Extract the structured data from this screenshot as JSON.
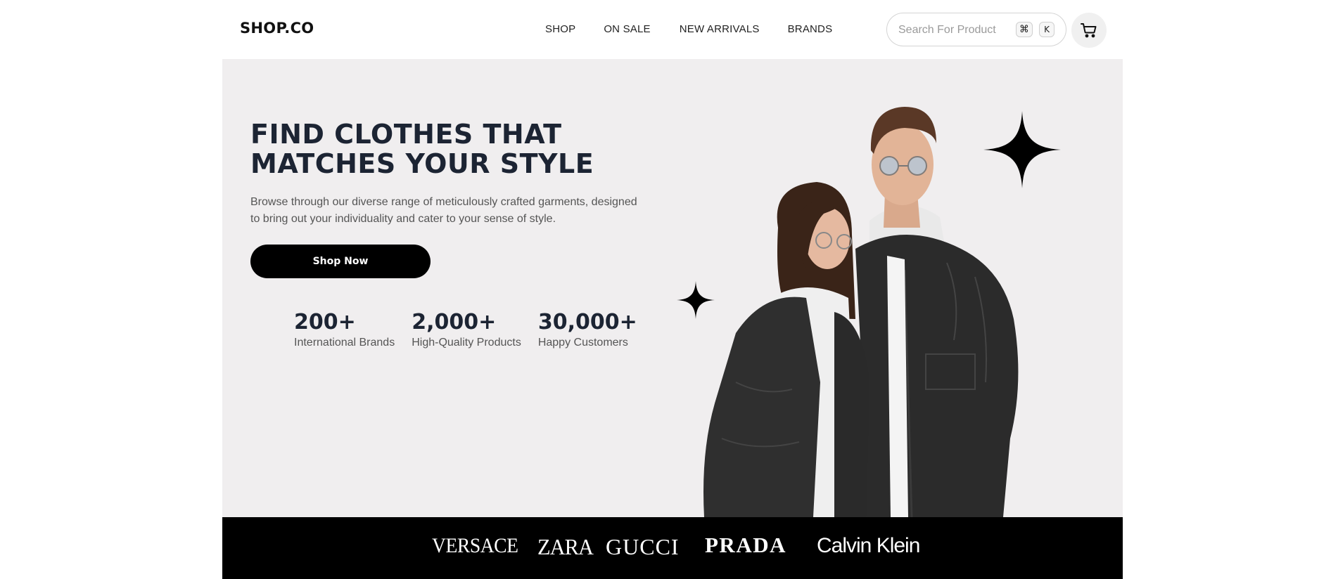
{
  "header": {
    "logo": "SHOP.CO",
    "nav": [
      {
        "label": "SHOP"
      },
      {
        "label": "ON SALE"
      },
      {
        "label": "NEW ARRIVALS"
      },
      {
        "label": "BRANDS"
      }
    ],
    "search": {
      "placeholder": "Search For Product",
      "shortcut_keys": [
        "⌘",
        "K"
      ]
    },
    "cart_icon": "cart-icon"
  },
  "hero": {
    "title": "FIND CLOTHES THAT MATCHES YOUR STYLE",
    "description": "Browse through our diverse range of meticulously crafted garments, designed to bring out your individuality and cater to your sense of style.",
    "cta_label": "Shop Now",
    "stats": [
      {
        "value": "200+",
        "label": "International Brands"
      },
      {
        "value": "2,000+",
        "label": "High-Quality Products"
      },
      {
        "value": "30,000+",
        "label": "Happy Customers"
      }
    ],
    "image_subject": "couple in black denim jackets and white hoodies"
  },
  "brands": [
    "VERSACE",
    "ZARA",
    "GUCCI",
    "PRADA",
    "Calvin Klein"
  ],
  "colors": {
    "hero_background": "#f0eeef",
    "heading": "#1c2433",
    "button": "#000000",
    "brand_bar": "#000000"
  }
}
